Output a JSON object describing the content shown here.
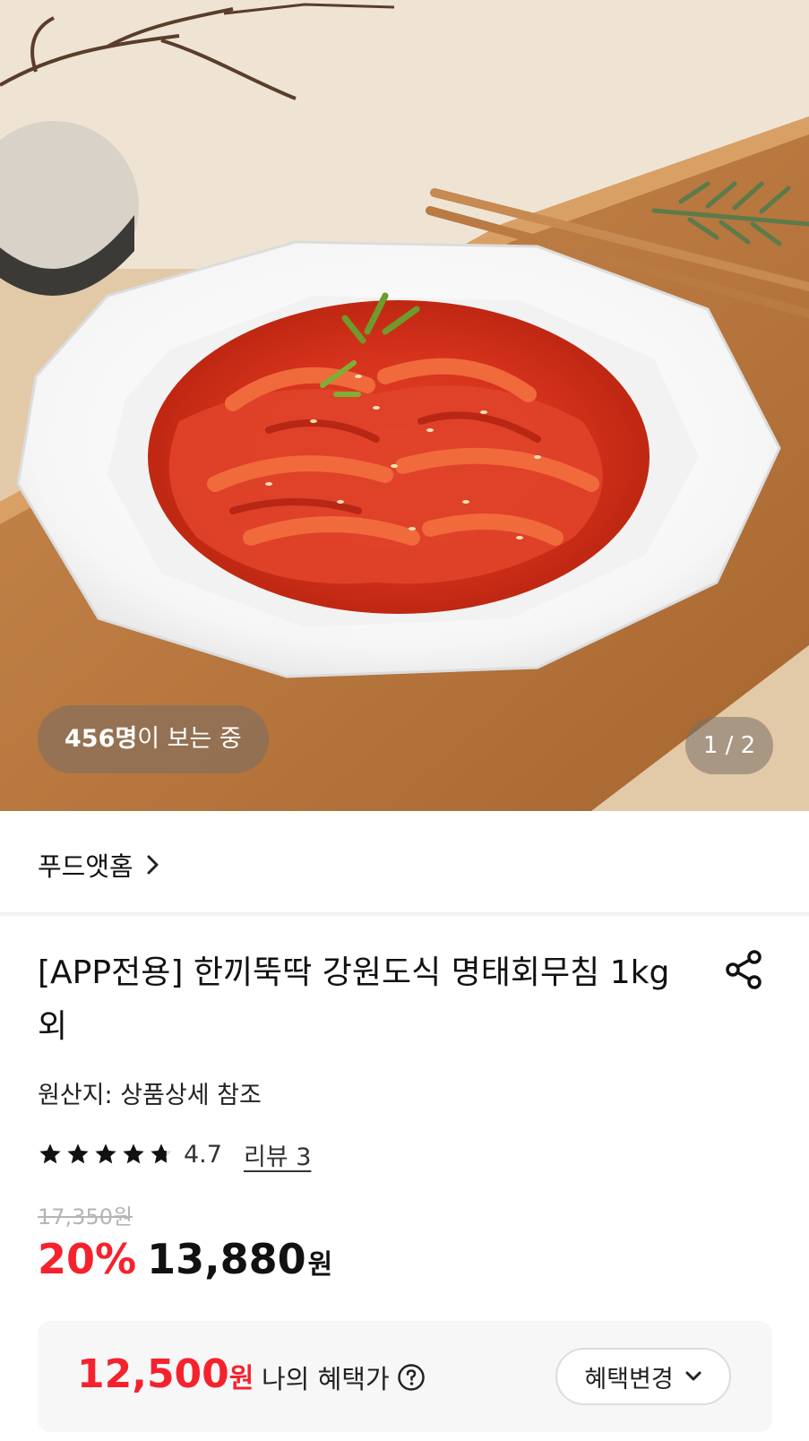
{
  "hero": {
    "image_alt": "",
    "viewers_count": "456명",
    "viewers_suffix": "이 보는 중",
    "page_indicator": "1 / 2"
  },
  "brand": {
    "name": "푸드앳홈",
    "chevron_icon": "chevron-right-icon"
  },
  "product": {
    "title": "[APP전용] 한끼뚝딱 강원도식 명태회무침 1kg 외",
    "share_icon": "share-icon",
    "origin": "원산지: 상품상세 참조",
    "rating": {
      "stars": 4.7,
      "value_label": "4.7",
      "review_label": "리뷰 3"
    },
    "original_price": "17,350원",
    "discount_rate": "20%",
    "sale_price": "13,880",
    "sale_price_unit": "원"
  },
  "benefit": {
    "price": "12,500",
    "price_unit": "원",
    "label": "나의 혜택가",
    "help_icon": "question-circle-icon",
    "change_button": "혜택변경",
    "change_button_icon": "chevron-down-icon"
  },
  "colors": {
    "accent_red": "#f5222d",
    "text_primary": "#111111",
    "strike_gray": "#b5b5b5",
    "benefit_bg": "#f7f7f8"
  }
}
